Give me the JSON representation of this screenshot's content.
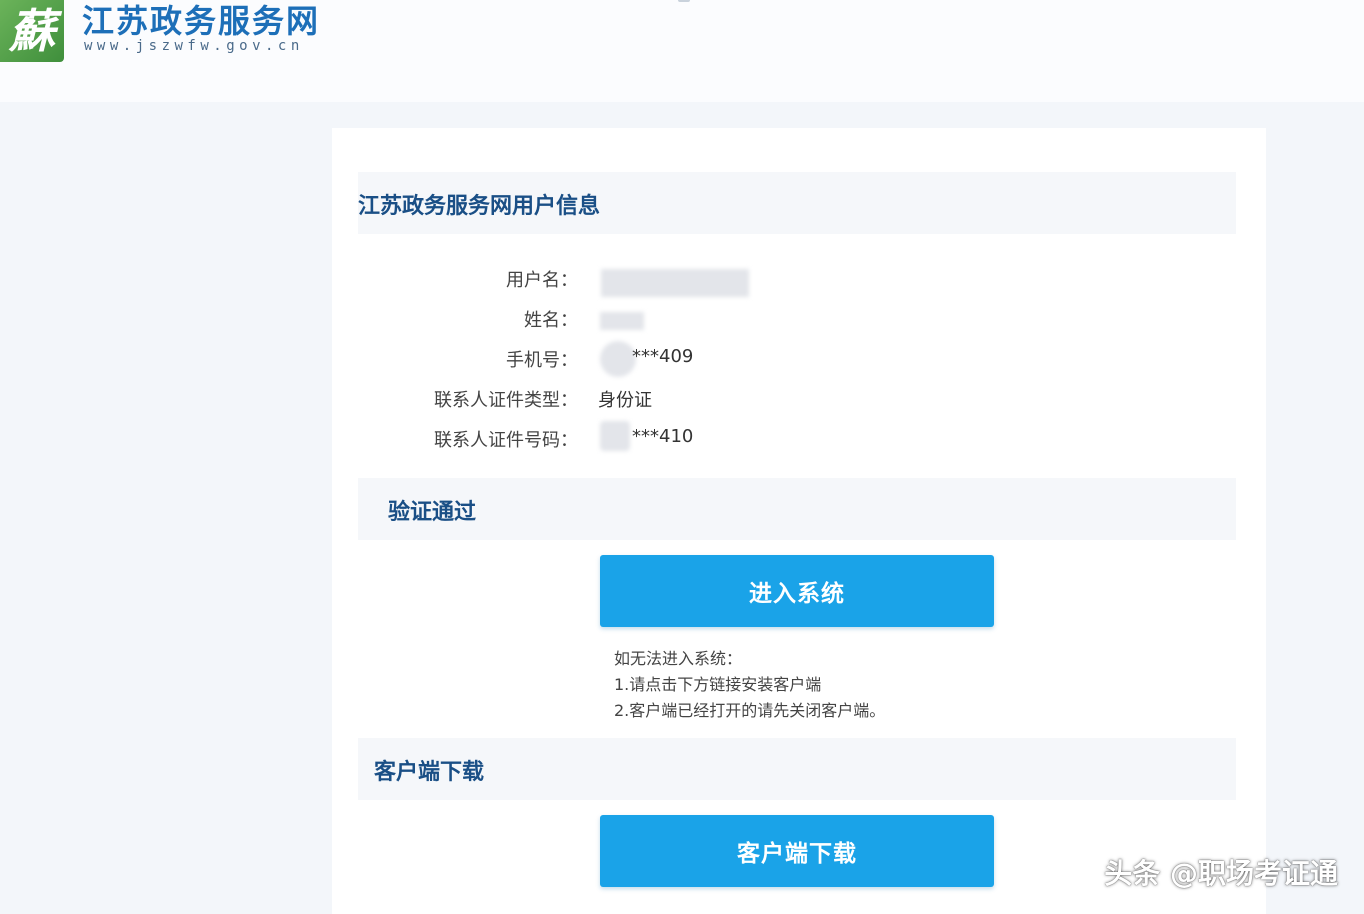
{
  "header": {
    "logo_char": "蘇",
    "site_title": "江苏政务服务网",
    "site_url": "www.jszwfw.gov.cn"
  },
  "user_info": {
    "section_title": "江苏政务服务网用户信息",
    "fields": [
      {
        "label": "用户名：",
        "value": ""
      },
      {
        "label": "姓名：",
        "value": ""
      },
      {
        "label": "手机号：",
        "value": "***409"
      },
      {
        "label": "联系人证件类型：",
        "value": "身份证"
      },
      {
        "label": "联系人证件号码：",
        "value": "***410"
      }
    ]
  },
  "verify": {
    "section_title": "验证通过",
    "enter_button": "进入系统",
    "hints": [
      "如无法进入系统：",
      "1.请点击下方链接安装客户端",
      "2.客户端已经打开的请先关闭客户端。"
    ]
  },
  "download": {
    "section_title": "客户端下载",
    "download_button": "客户端下载"
  },
  "watermark": "头条 @职场考证通",
  "colors": {
    "button": "#1aa3e8",
    "title": "#1a4f86",
    "brand": "#1d6fb8",
    "logo_green": "#4a9a42"
  }
}
